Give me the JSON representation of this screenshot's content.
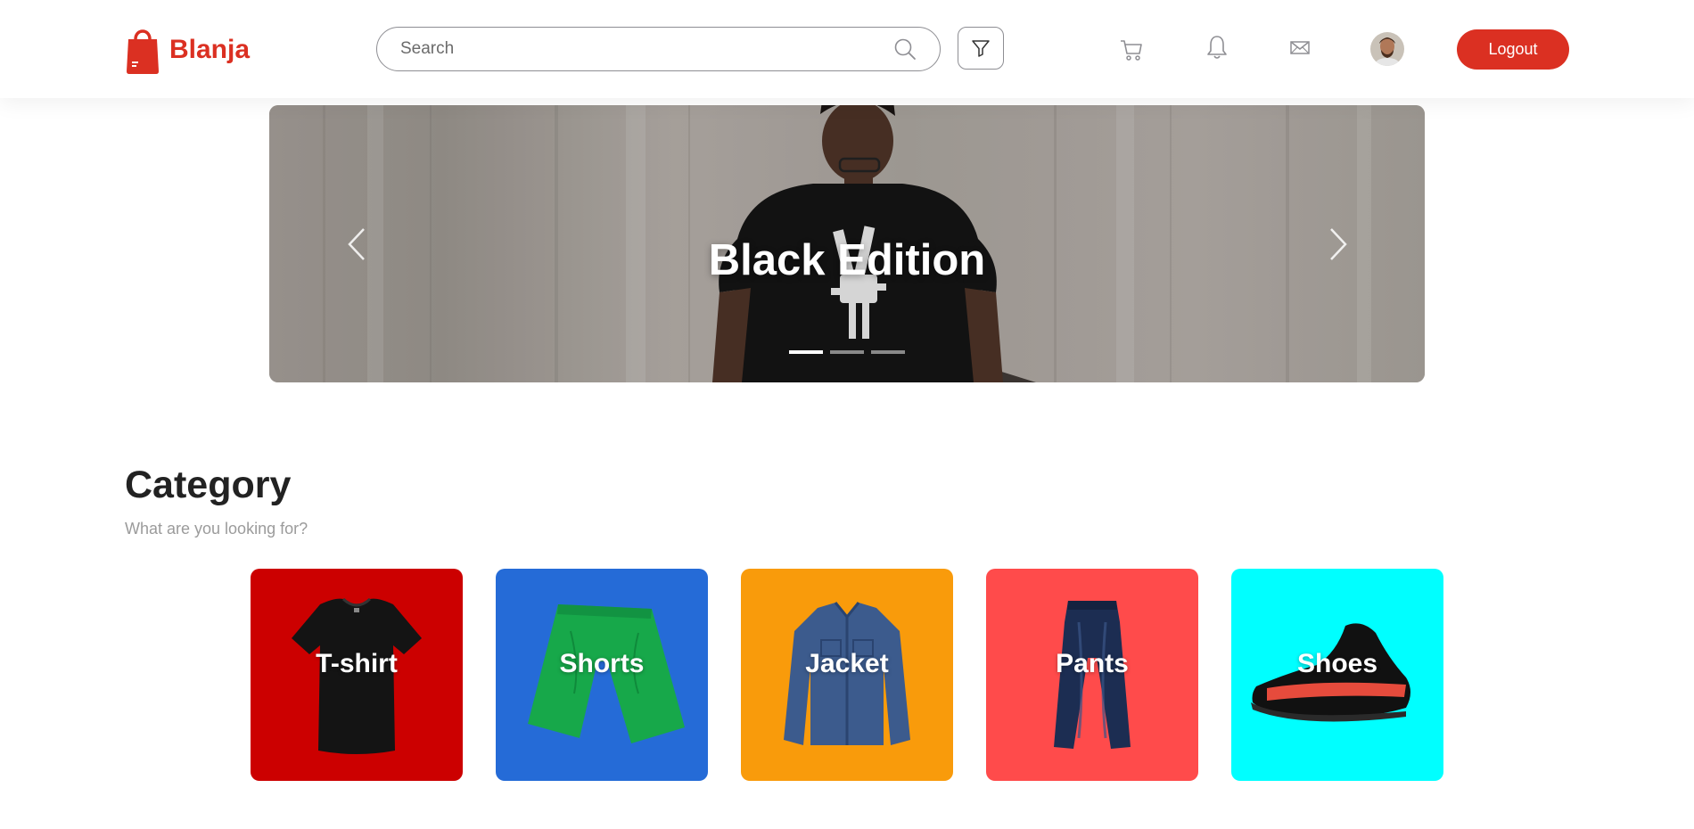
{
  "brand": {
    "name": "Blanja",
    "accent_color": "#DB3022"
  },
  "header": {
    "search": {
      "placeholder": "Search",
      "value": ""
    },
    "icons": [
      "search-icon",
      "filter-icon",
      "cart-icon",
      "bell-icon",
      "mail-icon"
    ],
    "logout_label": "Logout"
  },
  "carousel": {
    "title": "Black Edition",
    "slide_count": 3,
    "active_index": 0
  },
  "category": {
    "title": "Category",
    "subtitle": "What are you looking for?",
    "items": [
      {
        "label": "T-shirt",
        "color": "#CC0000"
      },
      {
        "label": "Shorts",
        "color": "#256BD7"
      },
      {
        "label": "Jacket",
        "color": "#F99B0B"
      },
      {
        "label": "Pants",
        "color": "#FF4B4B"
      },
      {
        "label": "Shoes",
        "color": "#00FFFF"
      }
    ]
  }
}
